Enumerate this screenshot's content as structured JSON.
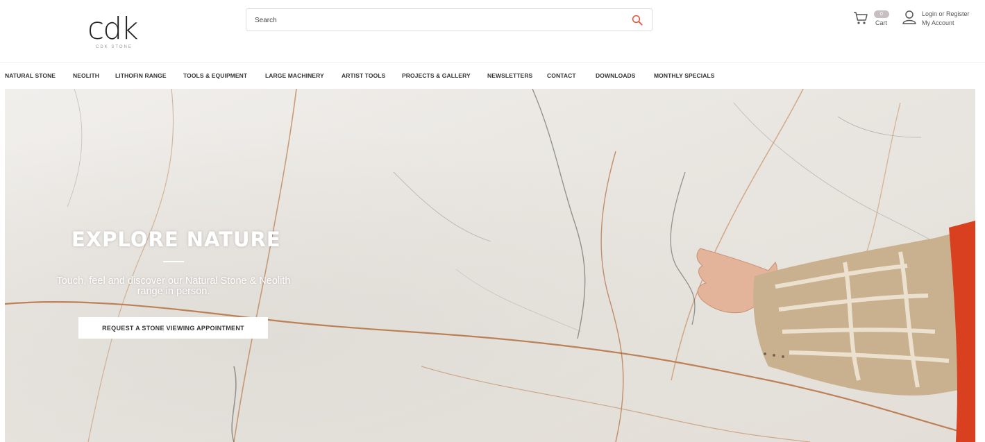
{
  "header": {
    "logo_text": "cdk",
    "logo_subtext": "CDK STONE",
    "search": {
      "placeholder": "Search"
    },
    "cart": {
      "count": "0",
      "label": "Cart"
    },
    "account": {
      "login_label": "Login or Register",
      "account_label": "My Account"
    },
    "icons": {
      "search": "search-icon",
      "cart": "cart-icon",
      "user": "user-icon"
    },
    "accent_color": "#e8503a"
  },
  "nav": {
    "items": [
      "NATURAL STONE",
      "NEOLITH",
      "LITHOFIN RANGE",
      "TOOLS & EQUIPMENT",
      "LARGE MACHINERY",
      "ARTIST TOOLS",
      "PROJECTS & GALLERY",
      "NEWSLETTERS",
      "CONTACT",
      "DOWNLOADS",
      "MONTHLY SPECIALS"
    ]
  },
  "hero": {
    "title": "EXPLORE NATURE",
    "subtitle": "Touch, feel and discover our Natural Stone & Neolith range in person.",
    "cta_label": "REQUEST A STONE VIEWING APPOINTMENT"
  }
}
